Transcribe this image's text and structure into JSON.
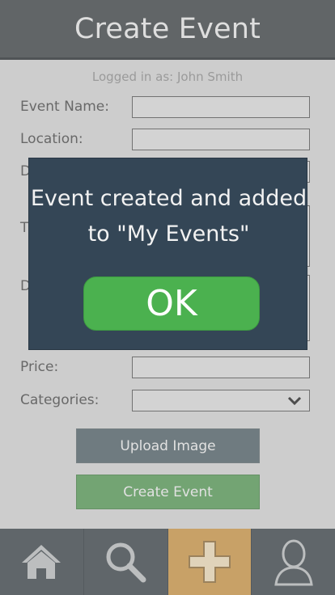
{
  "header": {
    "title": "Create Event"
  },
  "session": {
    "logged_in_text": "Logged in as: John Smith"
  },
  "form": {
    "event_name_label": "Event Name:",
    "location_label": "Location:",
    "date_label_partial": "D",
    "time_label_partial": "T",
    "description_label_partial": "D",
    "price_label": "Price:",
    "categories_label": "Categories:"
  },
  "buttons": {
    "upload_image": "Upload Image",
    "create_event": "Create Event"
  },
  "dialog": {
    "message": "Event created and added to \"My Events\"",
    "ok_label": "OK"
  },
  "tabbar": {
    "tabs": [
      {
        "icon": "home-icon",
        "active": false
      },
      {
        "icon": "search-icon",
        "active": false
      },
      {
        "icon": "plus-icon",
        "active": true
      },
      {
        "icon": "user-icon",
        "active": false
      }
    ]
  },
  "colors": {
    "header": "#444a4c",
    "dialog": "#344656",
    "ok_button": "#4bb14f",
    "active_tab": "#c8964c",
    "create_button": "#5c9a5c",
    "upload_button": "#56666c"
  }
}
